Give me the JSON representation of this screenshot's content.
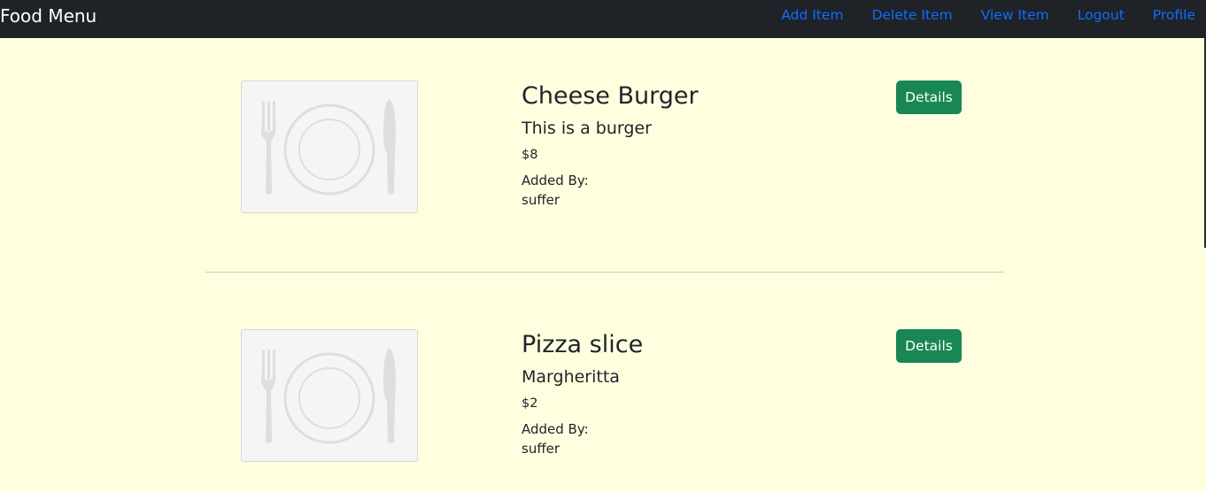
{
  "navbar": {
    "brand": "Food Menu",
    "links": [
      "Add Item",
      "Delete Item",
      "View Item",
      "Logout",
      "Profile"
    ]
  },
  "items": [
    {
      "name": "Cheese Burger",
      "description": "This is a burger",
      "price": "$8",
      "added_by_label": "Added By:",
      "added_by": "suffer",
      "button_label": "Details",
      "image_icon": "plate-fork-knife-icon"
    },
    {
      "name": "Pizza slice",
      "description": "Margheritta",
      "price": "$2",
      "added_by_label": "Added By:",
      "added_by": "suffer",
      "button_label": "Details",
      "image_icon": "plate-fork-knife-icon"
    }
  ],
  "colors": {
    "navbar_bg": "#1f2227",
    "page_bg": "#ffffe0",
    "link": "#0d6efd",
    "button": "#198754"
  }
}
